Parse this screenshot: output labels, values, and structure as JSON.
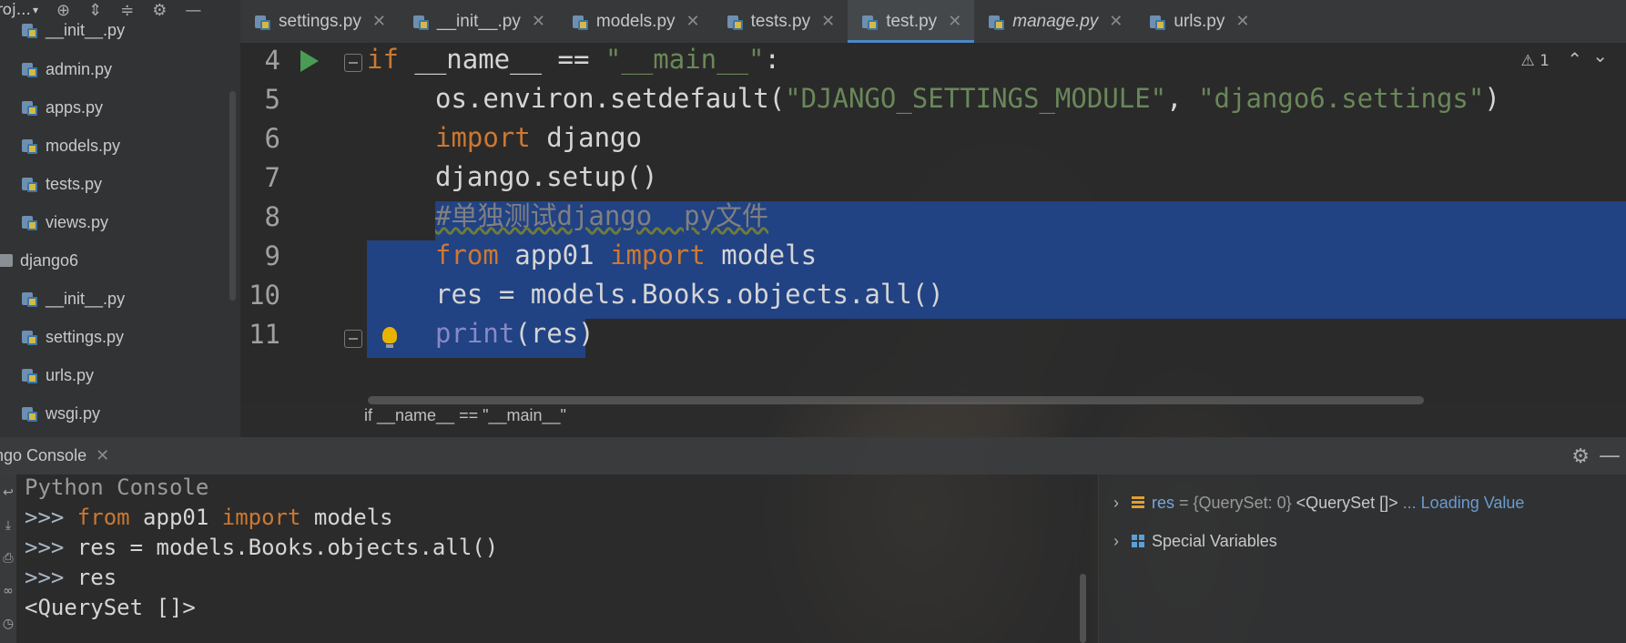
{
  "project_toolbar": {
    "title": "roj..."
  },
  "tree": [
    {
      "label": "__init__.py",
      "type": "py"
    },
    {
      "label": "admin.py",
      "type": "py"
    },
    {
      "label": "apps.py",
      "type": "py"
    },
    {
      "label": "models.py",
      "type": "py"
    },
    {
      "label": "tests.py",
      "type": "py"
    },
    {
      "label": "views.py",
      "type": "py"
    },
    {
      "label": "django6",
      "type": "folder"
    },
    {
      "label": "__init__.py",
      "type": "py"
    },
    {
      "label": "settings.py",
      "type": "py"
    },
    {
      "label": "urls.py",
      "type": "py"
    },
    {
      "label": "wsgi.py",
      "type": "py"
    }
  ],
  "tabs": [
    {
      "label": "settings.py"
    },
    {
      "label": "__init__.py"
    },
    {
      "label": "models.py"
    },
    {
      "label": "tests.py"
    },
    {
      "label": "test.py",
      "active": true
    },
    {
      "label": "manage.py",
      "italic": true
    },
    {
      "label": "urls.py"
    }
  ],
  "editor": {
    "line_numbers": [
      "4",
      "5",
      "6",
      "7",
      "8",
      "9",
      "10",
      "11"
    ],
    "inspection_count": "1",
    "lines": {
      "l4_kw": "if",
      "l4_a": " __name__ == ",
      "l4_str": "\"__main__\"",
      "l4_b": ":",
      "l5_a": "os.environ.setdefault(",
      "l5_s1": "\"DJANGO_SETTINGS_MODULE\"",
      "l5_b": ", ",
      "l5_s2": "\"django6.settings\"",
      "l5_c": ")",
      "l6_kw": "import",
      "l6_a": " django",
      "l7": "django.setup()",
      "l8_cmt": "#单独测试django  py文件",
      "l9_kw1": "from",
      "l9_a": " app01 ",
      "l9_kw2": "import",
      "l9_b": " models",
      "l10": "res = models.Books.objects.all()",
      "l11_bi": "print",
      "l11_a": "(res)"
    },
    "breadcrumb": "if __name__ == \"__main__\""
  },
  "console": {
    "tab_label": "ngo Console",
    "lines": {
      "c1": "Python Console",
      "c2_prompt": ">>> ",
      "c2_kw1": "from",
      "c2_a": " app01 ",
      "c2_kw2": "import",
      "c2_b": " models",
      "c3_prompt": ">>> ",
      "c3": "res = models.Books.objects.all()",
      "c4_prompt": ">>> ",
      "c4": "res",
      "c5": "<QuerySet []>"
    }
  },
  "variables": {
    "res_name": "res",
    "res_meta": " = {QuerySet: 0} ",
    "res_value": "<QuerySet []> ",
    "res_loading": "... Loading Value",
    "special": "Special Variables"
  },
  "colors": {
    "keyword": "#cc7832",
    "string": "#6a8759",
    "selection": "#214283",
    "builtin": "#8888c6",
    "tab_accent": "#4a88c7"
  }
}
